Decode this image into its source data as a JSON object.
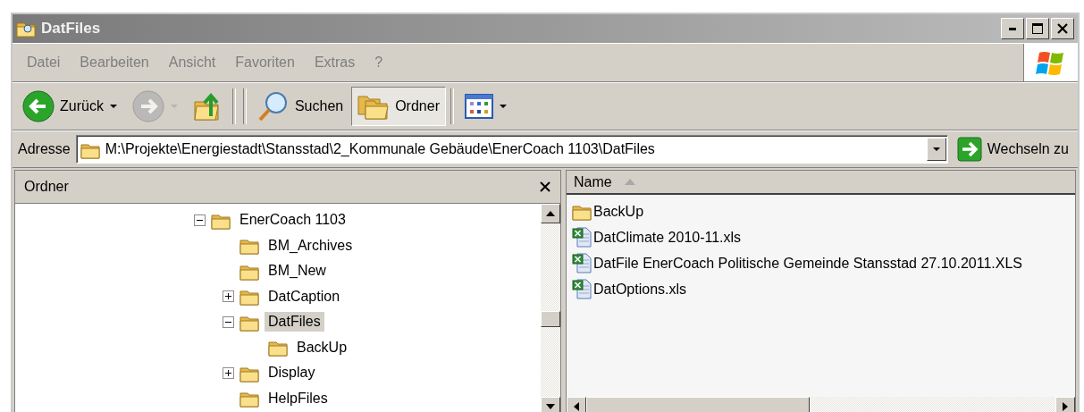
{
  "window": {
    "title": "DatFiles",
    "active": false
  },
  "menu": [
    {
      "label": "Datei"
    },
    {
      "label": "Bearbeiten"
    },
    {
      "label": "Ansicht"
    },
    {
      "label": "Favoriten"
    },
    {
      "label": "Extras"
    },
    {
      "label": "?"
    }
  ],
  "toolbar": [
    {
      "kind": "back",
      "label": "Zurück",
      "disabled": false,
      "pressed": false
    },
    {
      "kind": "forward",
      "disabled": true,
      "pressed": false
    },
    {
      "kind": "up",
      "disabled": false,
      "pressed": false
    },
    {
      "kind": "search",
      "label": "Suchen",
      "disabled": false,
      "pressed": false
    },
    {
      "kind": "folders",
      "label": "Ordner",
      "disabled": false,
      "pressed": true
    },
    {
      "kind": "views",
      "disabled": false,
      "pressed": false
    }
  ],
  "address": {
    "label": "Adresse",
    "value": "M:\\Projekte\\Energiestadt\\Stansstad\\2_Kommunale Gebäude\\EnerCoach 1103\\DatFiles",
    "go_label": "Wechseln zu"
  },
  "folder_pane": {
    "title": "Ordner",
    "tree": [
      {
        "label": "EnerCoach 1103",
        "expanded": true,
        "selected": false,
        "children": [
          {
            "label": "BM_Archives",
            "selected": false
          },
          {
            "label": "BM_New",
            "selected": false
          },
          {
            "label": "DatCaption",
            "expanded": false,
            "selected": false
          },
          {
            "label": "DatFiles",
            "expanded": true,
            "selected": true,
            "children": [
              {
                "label": "BackUp",
                "selected": false
              }
            ]
          },
          {
            "label": "Display",
            "expanded": false,
            "selected": false
          },
          {
            "label": "HelpFiles",
            "selected": false
          }
        ]
      }
    ]
  },
  "file_list": {
    "columns": [
      {
        "label": "Name",
        "sorted_ascending": true
      }
    ],
    "items": [
      {
        "name": "BackUp",
        "kind": "folder"
      },
      {
        "name": "DatClimate 2010-11.xls",
        "kind": "xls"
      },
      {
        "name": "DatFile EnerCoach Politische Gemeinde Stansstad 27.10.2011.XLS",
        "kind": "xls"
      },
      {
        "name": "DatOptions.xls",
        "kind": "xls"
      }
    ]
  }
}
